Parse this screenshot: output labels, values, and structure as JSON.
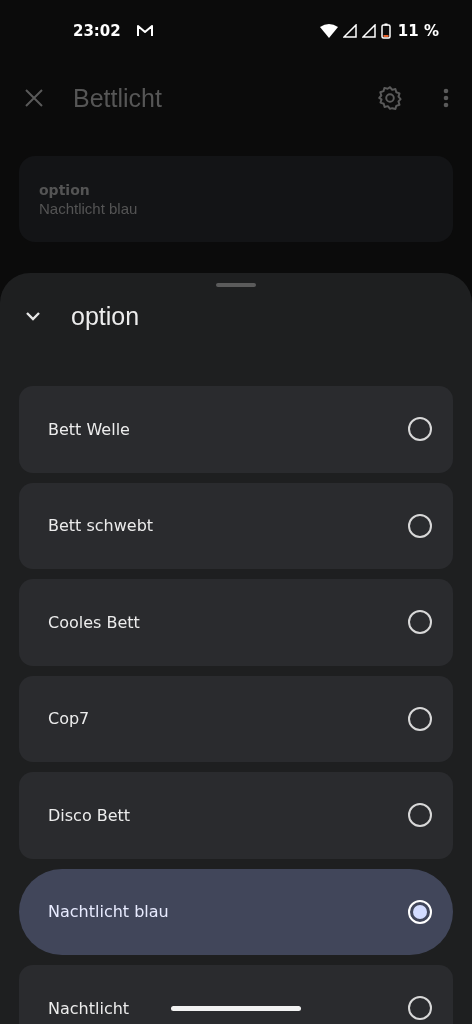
{
  "status_bar": {
    "time": "23:02",
    "battery": "11 %"
  },
  "app_bar": {
    "title": "Bettlicht"
  },
  "current": {
    "label": "option",
    "value": "Nachtlicht blau"
  },
  "sheet": {
    "title": "option",
    "options": [
      {
        "label": "Bett Welle",
        "selected": false
      },
      {
        "label": "Bett schwebt",
        "selected": false
      },
      {
        "label": "Cooles Bett",
        "selected": false
      },
      {
        "label": "Cop7",
        "selected": false
      },
      {
        "label": "Disco Bett",
        "selected": false
      },
      {
        "label": "Nachtlicht blau",
        "selected": true
      },
      {
        "label": "Nachtlicht",
        "selected": false
      }
    ]
  }
}
